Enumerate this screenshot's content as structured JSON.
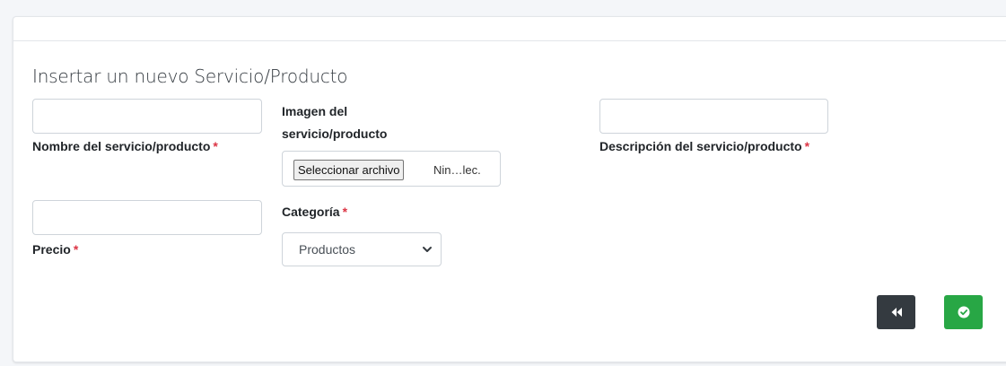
{
  "form": {
    "title": "Insertar un nuevo Servicio/Producto",
    "fields": {
      "name": {
        "label": "Nombre del servicio/producto",
        "required_mark": "*",
        "value": ""
      },
      "image": {
        "label_line1": "Imagen del",
        "label_line2": "servicio/producto",
        "button_label": "Seleccionar archivo",
        "file_name": "Nin…lec."
      },
      "description": {
        "label": "Descripción del servicio/producto",
        "required_mark": "*",
        "value": ""
      },
      "price": {
        "label": "Precio",
        "required_mark": "*",
        "value": ""
      },
      "category": {
        "label": "Categoría",
        "required_mark": "*",
        "selected": "Productos"
      }
    },
    "buttons": {
      "back_icon": "fast-backward-icon",
      "submit_icon": "check-circle-icon"
    }
  },
  "colors": {
    "required": "#dc3545",
    "back_button": "#343a40",
    "submit_button": "#28a745"
  }
}
